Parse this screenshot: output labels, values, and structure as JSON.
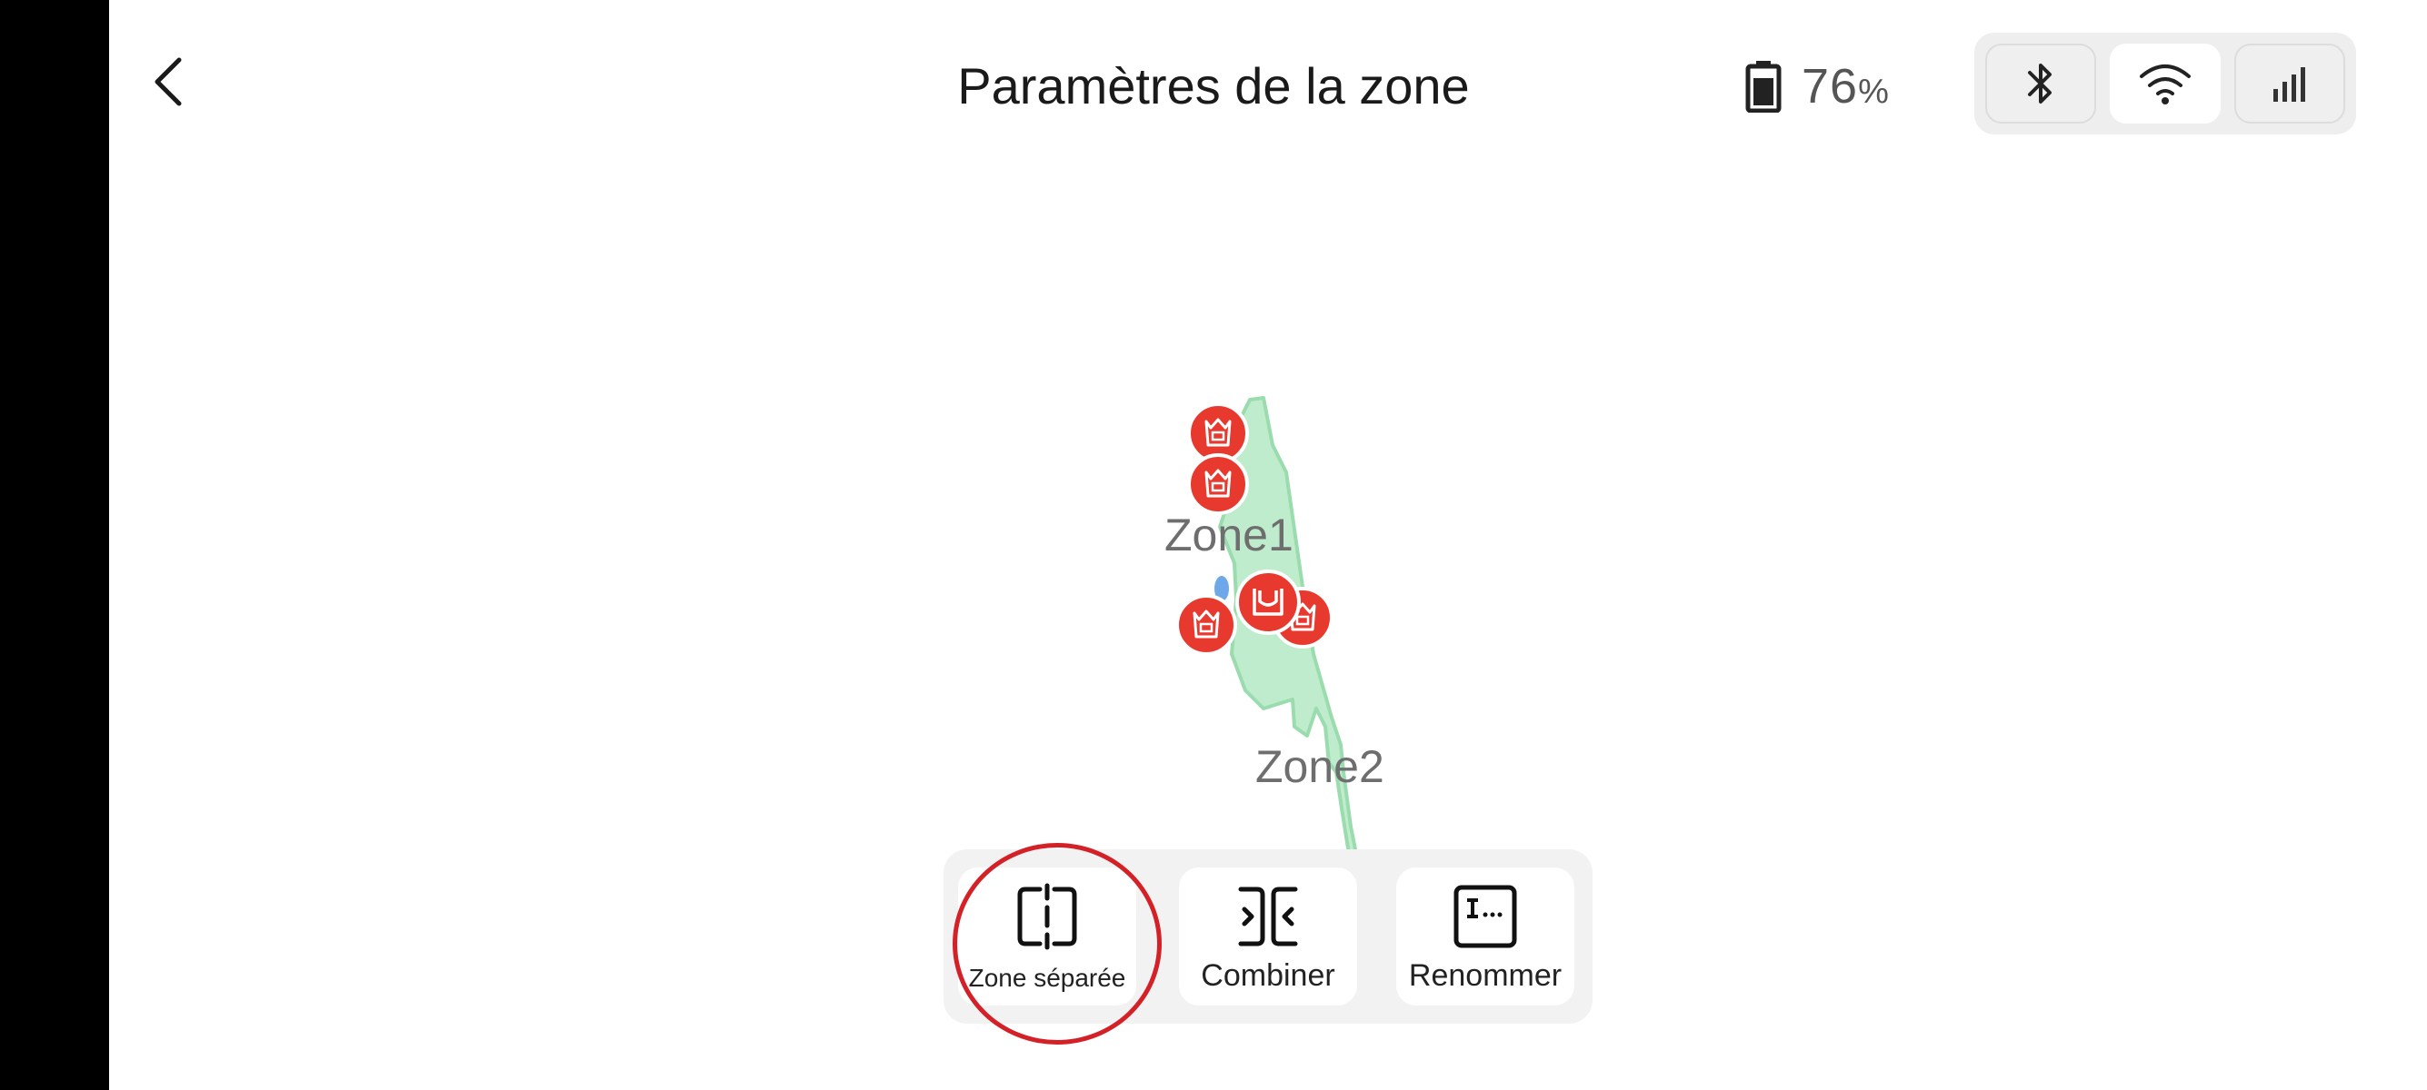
{
  "header": {
    "title": "Paramètres de la zone",
    "battery_value": "76",
    "battery_unit": "%"
  },
  "connections": [
    {
      "name": "bluetooth-icon",
      "active": false
    },
    {
      "name": "wifi-icon",
      "active": true
    },
    {
      "name": "cellular-signal-icon",
      "active": false
    }
  ],
  "map": {
    "zones": [
      {
        "label": "Zone1"
      },
      {
        "label": "Zone2"
      }
    ],
    "zone_color": "#bfeccd",
    "marker_color": "#e8392e"
  },
  "toolbar": {
    "split_label": "Zone séparée",
    "merge_label": "Combiner",
    "rename_label": "Renommer"
  },
  "colors": {
    "highlight": "#d42027"
  }
}
